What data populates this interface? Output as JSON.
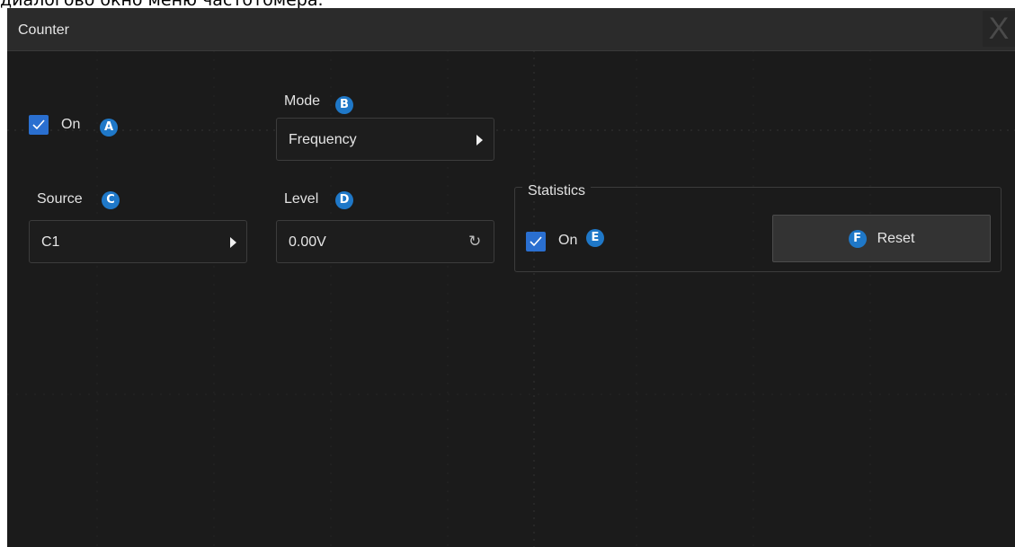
{
  "caption": "диалогово окно меню частотомера.",
  "dialog": {
    "title": "Counter",
    "close_label": "X"
  },
  "counter_on": {
    "label": "On",
    "badge": "A",
    "checked": true
  },
  "mode": {
    "label": "Mode",
    "badge": "B",
    "value": "Frequency"
  },
  "source": {
    "label": "Source",
    "badge": "C",
    "value": "C1"
  },
  "level": {
    "label": "Level",
    "badge": "D",
    "value": "0.00V"
  },
  "statistics": {
    "label": "Statistics",
    "on_label": "On",
    "on_badge": "E",
    "checked": true,
    "reset_label": "Reset",
    "reset_badge": "F"
  },
  "colors": {
    "background": "#1b1b1b",
    "titlebar": "#2b2b2b",
    "accent": "#2a6fd0",
    "badge": "#1f78c8"
  }
}
